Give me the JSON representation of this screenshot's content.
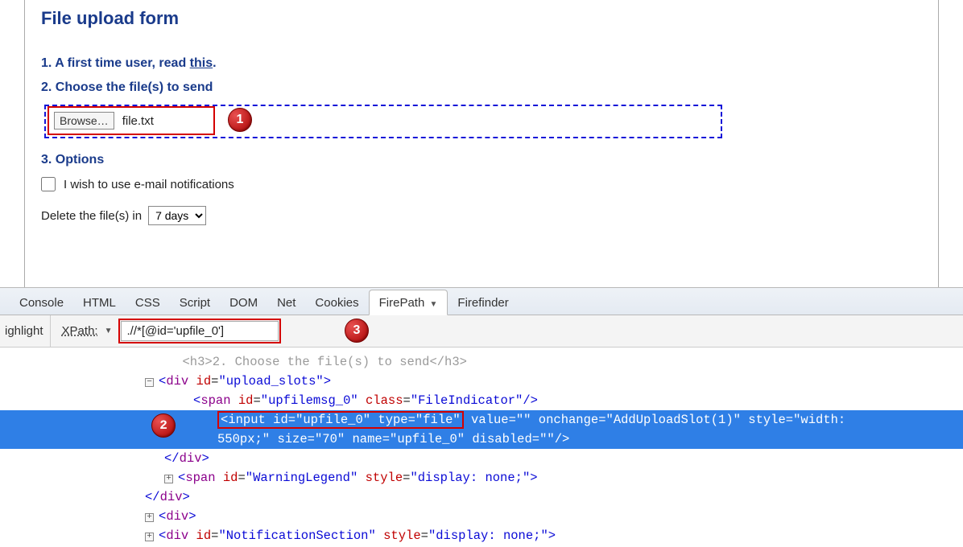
{
  "form": {
    "title": "File upload form",
    "step1_prefix": "1. A first time user, read ",
    "step1_link": "this",
    "step1_period": ".",
    "step2": "2. Choose the file(s) to send",
    "step3": "3. Options",
    "browse_label": "Browse…",
    "filename": "file.txt",
    "checkbox_label": "I wish to use e-mail notifications",
    "delete_label": "Delete the file(s) in",
    "delete_value": "7 days"
  },
  "badges": {
    "one": "1",
    "two": "2",
    "three": "3"
  },
  "devtools": {
    "tabs": [
      "Console",
      "HTML",
      "CSS",
      "Script",
      "DOM",
      "Net",
      "Cookies",
      "FirePath",
      "Firefinder"
    ],
    "active_tab": "FirePath",
    "highlight": "ighlight",
    "xpath_label": "XPath:",
    "xpath_value": ".//*[@id='upfile_0']"
  },
  "source": {
    "line_gray": "<h3>2. Choose the file(s) to send</h3>",
    "div_upload_open": "<div id=\"upload_slots\">",
    "span_upfilemsg": "<span id=\"upfilemsg_0\" class=\"FileIndicator\"/>",
    "input_red": "<input id=\"upfile_0\" type=\"file\"",
    "input_rest1": " value=\"\" onchange=\"AddUploadSlot(1)\" style=\"width:",
    "input_rest2": "550px;\" size=\"70\" name=\"upfile_0\" disabled=\"\"/>",
    "div_close": "</div>",
    "span_warning": "<span id=\"WarningLegend\" style=\"display: none;\">",
    "div_close2": "</div>",
    "div_open": "<div>",
    "div_notif": "<div id=\"NotificationSection\" style=\"display: none;\">"
  }
}
